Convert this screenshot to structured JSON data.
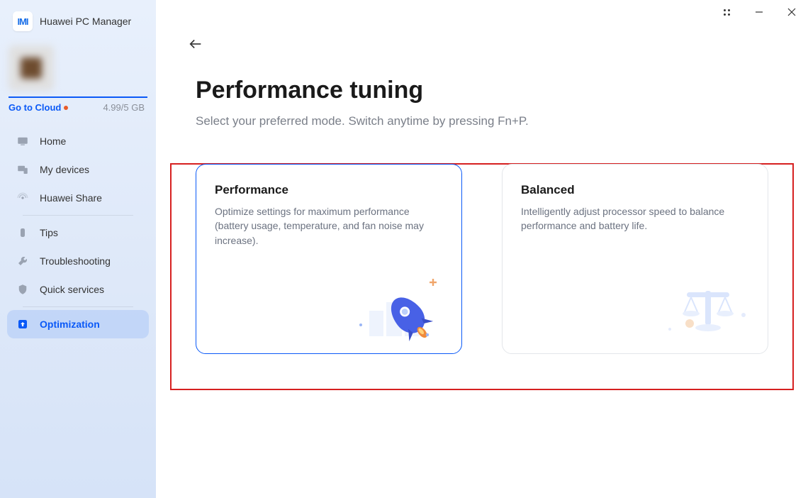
{
  "app": {
    "title": "Huawei PC Manager",
    "logoText": "IMI"
  },
  "cloud": {
    "link": "Go to Cloud",
    "usage": "4.99/5 GB"
  },
  "sidebar": {
    "groups": [
      [
        {
          "label": "Home",
          "icon": "monitor"
        },
        {
          "label": "My devices",
          "icon": "devices"
        },
        {
          "label": "Huawei Share",
          "icon": "share"
        }
      ],
      [
        {
          "label": "Tips",
          "icon": "info"
        },
        {
          "label": "Troubleshooting",
          "icon": "wrench"
        },
        {
          "label": "Quick services",
          "icon": "shield"
        }
      ],
      [
        {
          "label": "Optimization",
          "icon": "arrowup",
          "active": true
        }
      ]
    ]
  },
  "page": {
    "title": "Performance tuning",
    "subtitle": "Select your preferred mode. Switch anytime by pressing Fn+P."
  },
  "cards": [
    {
      "title": "Performance",
      "desc": "Optimize settings for maximum performance (battery usage, temperature, and fan noise may increase).",
      "selected": true,
      "illus": "rocket"
    },
    {
      "title": "Balanced",
      "desc": "Intelligently adjust processor speed to balance performance and battery life.",
      "selected": false,
      "illus": "scale"
    }
  ]
}
